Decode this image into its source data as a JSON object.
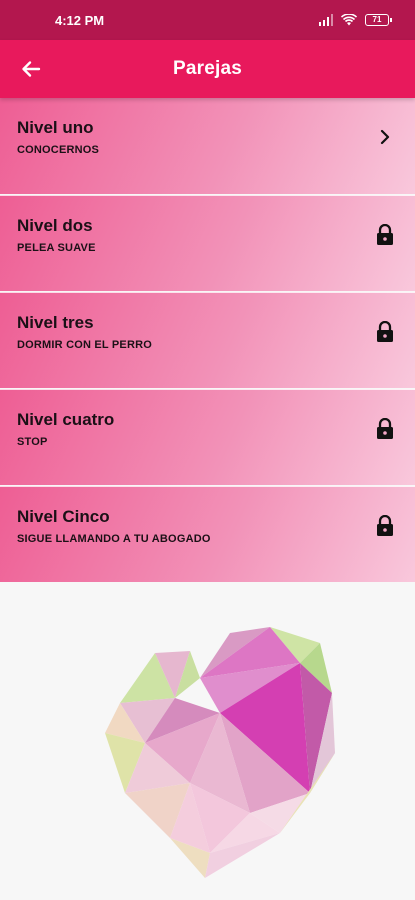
{
  "status_bar": {
    "time": "4:12 PM",
    "battery": "71",
    "icons": [
      "signal-icon",
      "wifi-icon",
      "battery-icon"
    ]
  },
  "app_bar": {
    "title": "Parejas",
    "back_icon": "arrow-left-icon"
  },
  "levels": [
    {
      "title": "Nivel uno",
      "subtitle": "CONOCERNOS",
      "icon": "chevron-right-icon",
      "locked": false
    },
    {
      "title": "Nivel dos",
      "subtitle": "PELEA SUAVE",
      "icon": "lock-icon",
      "locked": true
    },
    {
      "title": "Nivel tres",
      "subtitle": "DORMIR CON EL PERRO",
      "icon": "lock-icon",
      "locked": true
    },
    {
      "title": "Nivel cuatro",
      "subtitle": "STOP",
      "icon": "lock-icon",
      "locked": true
    },
    {
      "title": "Nivel Cinco",
      "subtitle": "SIGUE LLAMANDO A TU ABOGADO",
      "icon": "lock-icon",
      "locked": true
    }
  ],
  "colors": {
    "status_bar": "#b3174e",
    "app_bar": "#e8195c",
    "item_gradient_start": "#ee5e94",
    "item_gradient_end": "#f9c8dc",
    "heart_main": "#d83fb0",
    "heart_accent": "#c8e09a"
  }
}
